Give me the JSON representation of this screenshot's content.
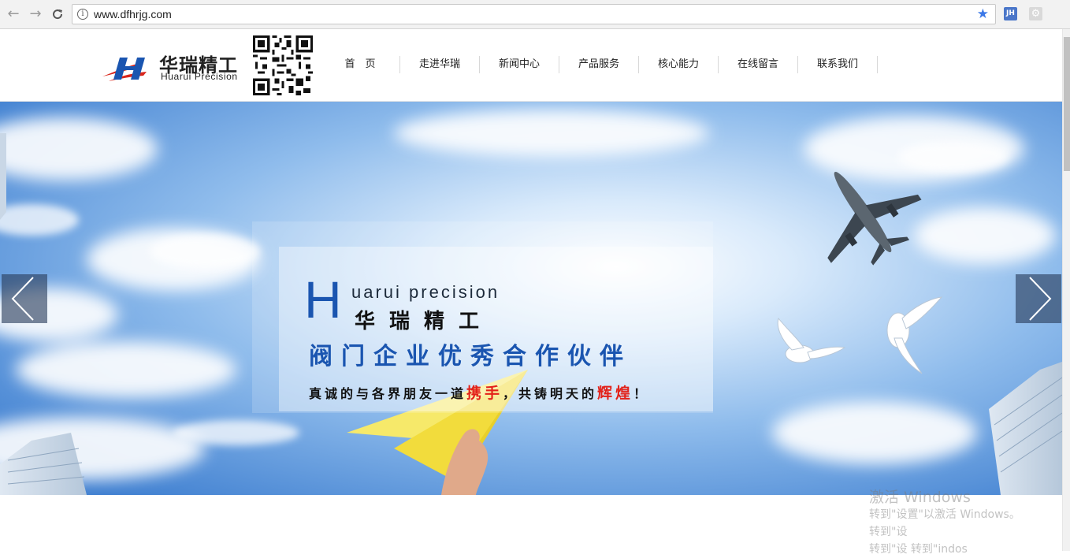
{
  "browser": {
    "url": "www.dfhrjg.com",
    "back_glyph": "←",
    "forward_glyph": "→",
    "reload_glyph": "C",
    "info_glyph": "i",
    "star_glyph": "★",
    "extension_jh": "JH",
    "extension_gear": "⚙"
  },
  "header": {
    "logo_name": "华瑞精工",
    "logo_en": "Huarui Precision",
    "nav": [
      "首　页",
      "走进华瑞",
      "新闻中心",
      "产品服务",
      "核心能力",
      "在线留言",
      "联系我们"
    ]
  },
  "banner": {
    "big_letter": "H",
    "title_en": "uarui precision",
    "title_cn": "华瑞精工",
    "slogan": "阀门企业优秀合作伙伴",
    "tagline_1": "真诚的与各界朋友一道",
    "tagline_hl_1": "携手",
    "tagline_2": "，共铸明天的",
    "tagline_hl_2": "辉煌",
    "tagline_3": "！"
  },
  "watermark": {
    "title": "激活 Windows",
    "line1": "转到\"设置\"以激活 Windows。",
    "line2": "转到\"设",
    "line3": "转到\"设 转到\"",
    "line3b": "indos"
  },
  "colors": {
    "brand_blue": "#1a55b0",
    "highlight_red": "#e32119",
    "logo_red": "#d9261c"
  }
}
